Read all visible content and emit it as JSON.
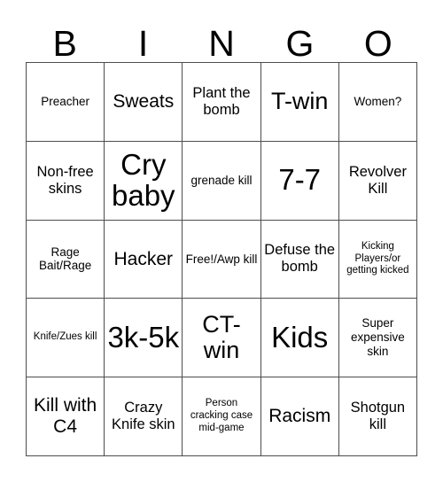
{
  "card": {
    "title": "BINGO",
    "header_letters": [
      "B",
      "I",
      "N",
      "G",
      "O"
    ],
    "columns": 5,
    "rows": 5,
    "colors": {
      "background": "#ffffff",
      "text": "#000000",
      "grid_line": "#4d4d4d"
    },
    "cells": [
      {
        "text": "Preacher",
        "size": "sm"
      },
      {
        "text": "Sweats",
        "size": "lg"
      },
      {
        "text": "Plant the bomb",
        "size": "md"
      },
      {
        "text": "T-win",
        "size": "xl"
      },
      {
        "text": "Women?",
        "size": "sm"
      },
      {
        "text": "Non-free skins",
        "size": "md"
      },
      {
        "text": "Cry baby",
        "size": "xxl"
      },
      {
        "text": "grenade kill",
        "size": "sm"
      },
      {
        "text": "7-7",
        "size": "xxl"
      },
      {
        "text": "Revolver Kill",
        "size": "md"
      },
      {
        "text": "Rage Bait/Rage",
        "size": "sm"
      },
      {
        "text": "Hacker",
        "size": "lg"
      },
      {
        "text": "Free!/Awp kill",
        "size": "sm"
      },
      {
        "text": "Defuse the bomb",
        "size": "md"
      },
      {
        "text": "Kicking Players/or getting kicked",
        "size": "xs"
      },
      {
        "text": "Knife/Zues kill",
        "size": "xs"
      },
      {
        "text": "3k-5k",
        "size": "xxl"
      },
      {
        "text": "CT-win",
        "size": "xl"
      },
      {
        "text": "Kids",
        "size": "xxl"
      },
      {
        "text": "Super expensive skin",
        "size": "sm"
      },
      {
        "text": "Kill with C4",
        "size": "lg"
      },
      {
        "text": "Crazy Knife skin",
        "size": "md"
      },
      {
        "text": "Person cracking case mid-game",
        "size": "xs"
      },
      {
        "text": "Racism",
        "size": "lg"
      },
      {
        "text": "Shotgun kill",
        "size": "md"
      }
    ]
  }
}
